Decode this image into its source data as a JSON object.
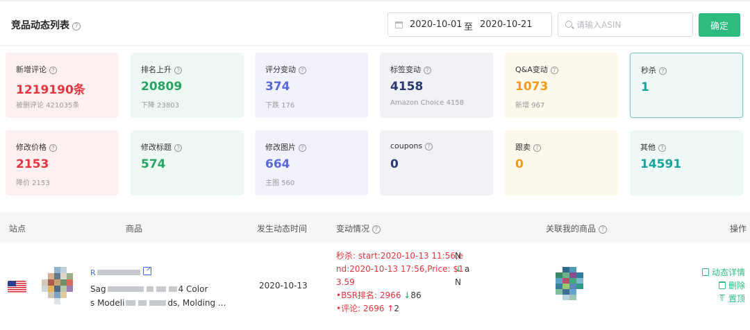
{
  "header": {
    "title": "竞品动态列表",
    "help": "?",
    "date_start": "2020-10-01",
    "date_sep": "至",
    "date_end": "2020-10-21",
    "search_placeholder": "请输入ASIN",
    "search_value": "",
    "confirm_label": "确定"
  },
  "cards": [
    {
      "label": "新增评论",
      "value": "1219190条",
      "sub": "被删评论 421035条",
      "color": "#e5353e"
    },
    {
      "label": "排名上升",
      "value": "20809",
      "sub": "下降 23803",
      "color": "#27a462"
    },
    {
      "label": "评分变动",
      "value": "374",
      "sub": "下跌 176",
      "color": "#5a68d7"
    },
    {
      "label": "标签变动",
      "value": "4158",
      "sub": "Amazon Choice 4158",
      "color": "#2b3a6e"
    },
    {
      "label": "Q&A变动",
      "value": "1073",
      "sub": "新增 967",
      "color": "#f39a1b"
    },
    {
      "label": "秒杀",
      "value": "1",
      "sub": "",
      "color": "#1ba49a",
      "selected": true
    },
    {
      "label": "修改价格",
      "value": "2153",
      "sub": "降价 2153",
      "color": "#e5353e"
    },
    {
      "label": "修改标题",
      "value": "574",
      "sub": "",
      "color": "#27a462"
    },
    {
      "label": "修改图片",
      "value": "664",
      "sub": "主图 560",
      "color": "#5a68d7"
    },
    {
      "label": "coupons",
      "value": "0",
      "sub": "",
      "color": "#2b3a6e"
    },
    {
      "label": "跟卖",
      "value": "0",
      "sub": "",
      "color": "#f39a1b"
    },
    {
      "label": "其他",
      "value": "14591",
      "sub": "",
      "color": "#1ba49a"
    }
  ],
  "table": {
    "headers": {
      "site": "站点",
      "product": "商品",
      "time": "发生动态时间",
      "change": "变动情况",
      "related": "关联我的商品",
      "ops": "操作"
    },
    "rows": [
      {
        "site_icon": "us-flag-icon",
        "product_title_prefix": "R",
        "product_desc_1_prefix": "Sag",
        "product_desc_1_suffix": "4 Color",
        "product_desc_2_prefix": "s Modeli",
        "product_desc_2_suffix": "ds, Molding ...",
        "date": "2020-10-13",
        "change_flash_1": "秒杀: start:2020-10-13 11:56,e",
        "change_flash_2": "nd:2020-10-13 17:56,Price: $1",
        "change_flash_3": "3.59",
        "bsr_label": "•BSR排名: 2966",
        "bsr_arrow": "↓",
        "bsr_delta": "86",
        "review_label": "•评论: 2696",
        "review_arrow": "↑",
        "review_delta": "2",
        "na_1": "N",
        "na_2_arrow": "↓",
        "na_2": "a",
        "na_3": "N",
        "op_detail": "动态详情",
        "op_delete": "删除",
        "op_top": "置顶"
      }
    ]
  }
}
